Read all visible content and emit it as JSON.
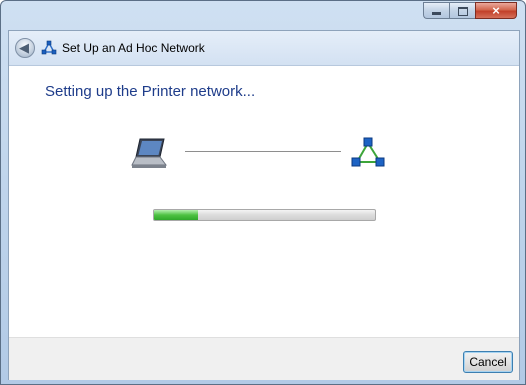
{
  "window": {
    "title": "Set Up an Ad Hoc Network",
    "buttons": {
      "close_glyph": "×"
    }
  },
  "wizard": {
    "heading": "Setting up the Printer network...",
    "progress_fraction": 0.2
  },
  "footer": {
    "cancel_label": "Cancel"
  },
  "icons": [
    "back-arrow-icon",
    "adhoc-network-icon",
    "laptop-icon",
    "network-icon"
  ],
  "colors": {
    "heading": "#1e3c8a",
    "progress": "#4ec243",
    "close_button": "#c2402a"
  }
}
